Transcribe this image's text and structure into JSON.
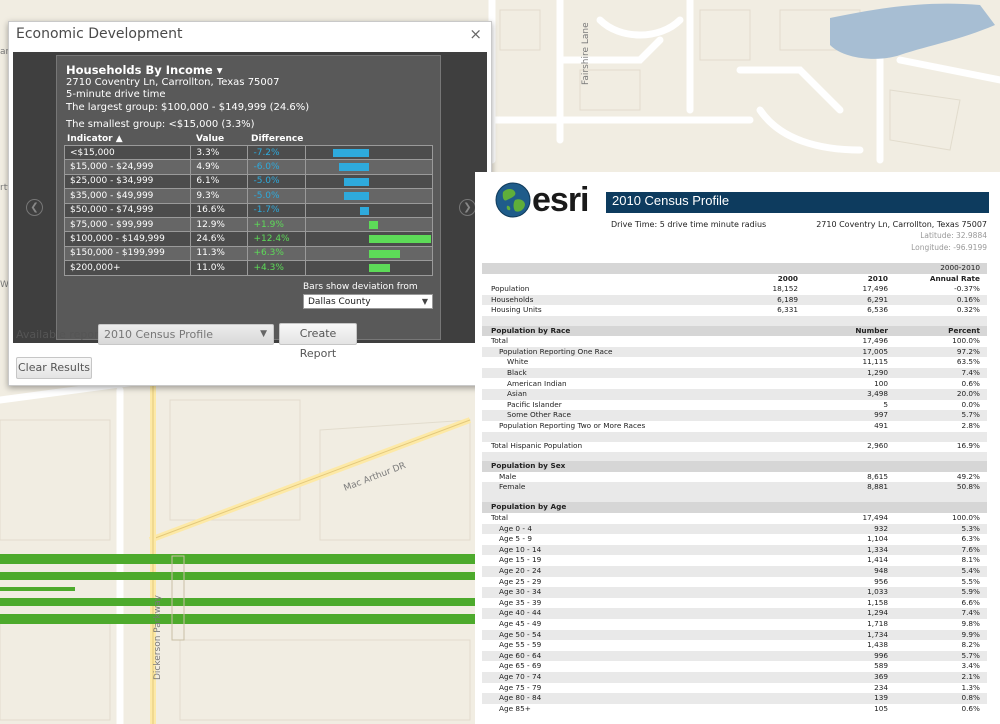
{
  "colors": {
    "road_major": "#4daa2c",
    "map_bg": "#f1ede2",
    "bar_negative": "#2eaadc",
    "bar_positive": "#5ddb58",
    "esri_bar": "#0d3b5e"
  },
  "map": {
    "street_labels": [
      "Mac Arthur DR",
      "Dickerson Parkway",
      "Fairshire Lane",
      "Wa",
      "an",
      "rtv"
    ]
  },
  "econ": {
    "title": "Economic Development",
    "close_icon": "close-icon",
    "card": {
      "title": "Households By Income ▾",
      "address": "2710 Coventry Ln, Carrollton, Texas 75007",
      "drive_time": "5-minute drive time",
      "largest": "The largest group: $100,000 - $149,999 (24.6%)",
      "smallest": "The smallest group: <$15,000 (3.3%)",
      "col_indicator": "Indicator ▲",
      "col_value": "Value",
      "col_difference": "Difference",
      "rows": [
        {
          "label": "<$15,000",
          "value": "3.3%",
          "diff": "-7.2%",
          "d": -7.2
        },
        {
          "label": "$15,000 - $24,999",
          "value": "4.9%",
          "diff": "-6.0%",
          "d": -6.0
        },
        {
          "label": "$25,000 - $34,999",
          "value": "6.1%",
          "diff": "-5.0%",
          "d": -5.0
        },
        {
          "label": "$35,000 - $49,999",
          "value": "9.3%",
          "diff": "-5.0%",
          "d": -5.0
        },
        {
          "label": "$50,000 - $74,999",
          "value": "16.6%",
          "diff": "-1.7%",
          "d": -1.7
        },
        {
          "label": "$75,000 - $99,999",
          "value": "12.9%",
          "diff": "+1.9%",
          "d": 1.9
        },
        {
          "label": "$100,000 - $149,999",
          "value": "24.6%",
          "diff": "+12.4%",
          "d": 12.4
        },
        {
          "label": "$150,000 - $199,999",
          "value": "11.3%",
          "diff": "+6.3%",
          "d": 6.3
        },
        {
          "label": "$200,000+",
          "value": "11.0%",
          "diff": "+4.3%",
          "d": 4.3
        }
      ],
      "bars_note": "Bars show deviation from",
      "county": "Dallas County"
    },
    "available_reports_label": "Available reports",
    "report_select": "2010 Census Profile",
    "create_report": "Create Report",
    "clear_results": "Clear Results"
  },
  "report": {
    "wordmark": "esri",
    "title": "2010 Census Profile",
    "drive_time": "Drive Time: 5 drive time minute radius",
    "address": "2710 Coventry Ln, Carrollton, Texas 75007",
    "latitude": "Latitude: 32.9884",
    "longitude": "Longitude: -96.9199",
    "rows": [
      {
        "type": "header-bar",
        "cells": [
          "",
          "",
          "",
          "2000-2010"
        ]
      },
      {
        "type": "plain",
        "bold": true,
        "cells": [
          "",
          "2000",
          "2010",
          "Annual Rate"
        ]
      },
      {
        "type": "plain",
        "cells": [
          "Population",
          "18,152",
          "17,496",
          "-0.37%"
        ]
      },
      {
        "type": "shaded",
        "cells": [
          "Households",
          "6,189",
          "6,291",
          "0.16%"
        ]
      },
      {
        "type": "plain",
        "cells": [
          "Housing Units",
          "6,331",
          "6,536",
          "0.32%"
        ]
      },
      {
        "type": "gap",
        "cells": [
          "",
          "",
          "",
          ""
        ]
      },
      {
        "type": "header-bar",
        "bold": true,
        "cells": [
          "Population by Race",
          "",
          "Number",
          "Percent"
        ]
      },
      {
        "type": "plain",
        "cells": [
          "Total",
          "",
          "17,496",
          "100.0%"
        ]
      },
      {
        "type": "shaded",
        "indent": 1,
        "cells": [
          "Population Reporting One Race",
          "",
          "17,005",
          "97.2%"
        ]
      },
      {
        "type": "plain",
        "indent": 2,
        "cells": [
          "White",
          "",
          "11,115",
          "63.5%"
        ]
      },
      {
        "type": "shaded",
        "indent": 2,
        "cells": [
          "Black",
          "",
          "1,290",
          "7.4%"
        ]
      },
      {
        "type": "plain",
        "indent": 2,
        "cells": [
          "American Indian",
          "",
          "100",
          "0.6%"
        ]
      },
      {
        "type": "shaded",
        "indent": 2,
        "cells": [
          "Asian",
          "",
          "3,498",
          "20.0%"
        ]
      },
      {
        "type": "plain",
        "indent": 2,
        "cells": [
          "Pacific Islander",
          "",
          "5",
          "0.0%"
        ]
      },
      {
        "type": "shaded",
        "indent": 2,
        "cells": [
          "Some Other Race",
          "",
          "997",
          "5.7%"
        ]
      },
      {
        "type": "plain",
        "indent": 1,
        "cells": [
          "Population Reporting Two or More Races",
          "",
          "491",
          "2.8%"
        ]
      },
      {
        "type": "gap",
        "cells": [
          "",
          "",
          "",
          ""
        ]
      },
      {
        "type": "plain",
        "cells": [
          "Total Hispanic Population",
          "",
          "2,960",
          "16.9%"
        ]
      },
      {
        "type": "gap",
        "cells": [
          "",
          "",
          "",
          ""
        ]
      },
      {
        "type": "header-bar",
        "bold": true,
        "cells": [
          "Population by Sex",
          "",
          "",
          ""
        ]
      },
      {
        "type": "plain",
        "indent": 1,
        "cells": [
          "Male",
          "",
          "8,615",
          "49.2%"
        ]
      },
      {
        "type": "shaded",
        "indent": 1,
        "cells": [
          "Female",
          "",
          "8,881",
          "50.8%"
        ]
      },
      {
        "type": "gap",
        "cells": [
          "",
          "",
          "",
          ""
        ]
      },
      {
        "type": "header-bar",
        "bold": true,
        "cells": [
          "Population by Age",
          "",
          "",
          ""
        ]
      },
      {
        "type": "plain",
        "cells": [
          "Total",
          "",
          "17,494",
          "100.0%"
        ]
      },
      {
        "type": "shaded",
        "indent": 1,
        "cells": [
          "Age 0 - 4",
          "",
          "932",
          "5.3%"
        ]
      },
      {
        "type": "plain",
        "indent": 1,
        "cells": [
          "Age 5 - 9",
          "",
          "1,104",
          "6.3%"
        ]
      },
      {
        "type": "shaded",
        "indent": 1,
        "cells": [
          "Age 10 - 14",
          "",
          "1,334",
          "7.6%"
        ]
      },
      {
        "type": "plain",
        "indent": 1,
        "cells": [
          "Age 15 - 19",
          "",
          "1,414",
          "8.1%"
        ]
      },
      {
        "type": "shaded",
        "indent": 1,
        "cells": [
          "Age 20 - 24",
          "",
          "948",
          "5.4%"
        ]
      },
      {
        "type": "plain",
        "indent": 1,
        "cells": [
          "Age 25 - 29",
          "",
          "956",
          "5.5%"
        ]
      },
      {
        "type": "shaded",
        "indent": 1,
        "cells": [
          "Age 30 - 34",
          "",
          "1,033",
          "5.9%"
        ]
      },
      {
        "type": "plain",
        "indent": 1,
        "cells": [
          "Age 35 - 39",
          "",
          "1,158",
          "6.6%"
        ]
      },
      {
        "type": "shaded",
        "indent": 1,
        "cells": [
          "Age 40 - 44",
          "",
          "1,294",
          "7.4%"
        ]
      },
      {
        "type": "plain",
        "indent": 1,
        "cells": [
          "Age 45 - 49",
          "",
          "1,718",
          "9.8%"
        ]
      },
      {
        "type": "shaded",
        "indent": 1,
        "cells": [
          "Age 50 - 54",
          "",
          "1,734",
          "9.9%"
        ]
      },
      {
        "type": "plain",
        "indent": 1,
        "cells": [
          "Age 55 - 59",
          "",
          "1,438",
          "8.2%"
        ]
      },
      {
        "type": "shaded",
        "indent": 1,
        "cells": [
          "Age 60 - 64",
          "",
          "996",
          "5.7%"
        ]
      },
      {
        "type": "plain",
        "indent": 1,
        "cells": [
          "Age 65 - 69",
          "",
          "589",
          "3.4%"
        ]
      },
      {
        "type": "shaded",
        "indent": 1,
        "cells": [
          "Age 70 - 74",
          "",
          "369",
          "2.1%"
        ]
      },
      {
        "type": "plain",
        "indent": 1,
        "cells": [
          "Age 75 - 79",
          "",
          "234",
          "1.3%"
        ]
      },
      {
        "type": "shaded",
        "indent": 1,
        "cells": [
          "Age 80 - 84",
          "",
          "139",
          "0.8%"
        ]
      },
      {
        "type": "plain",
        "indent": 1,
        "cells": [
          "Age 85+",
          "",
          "105",
          "0.6%"
        ]
      }
    ]
  }
}
